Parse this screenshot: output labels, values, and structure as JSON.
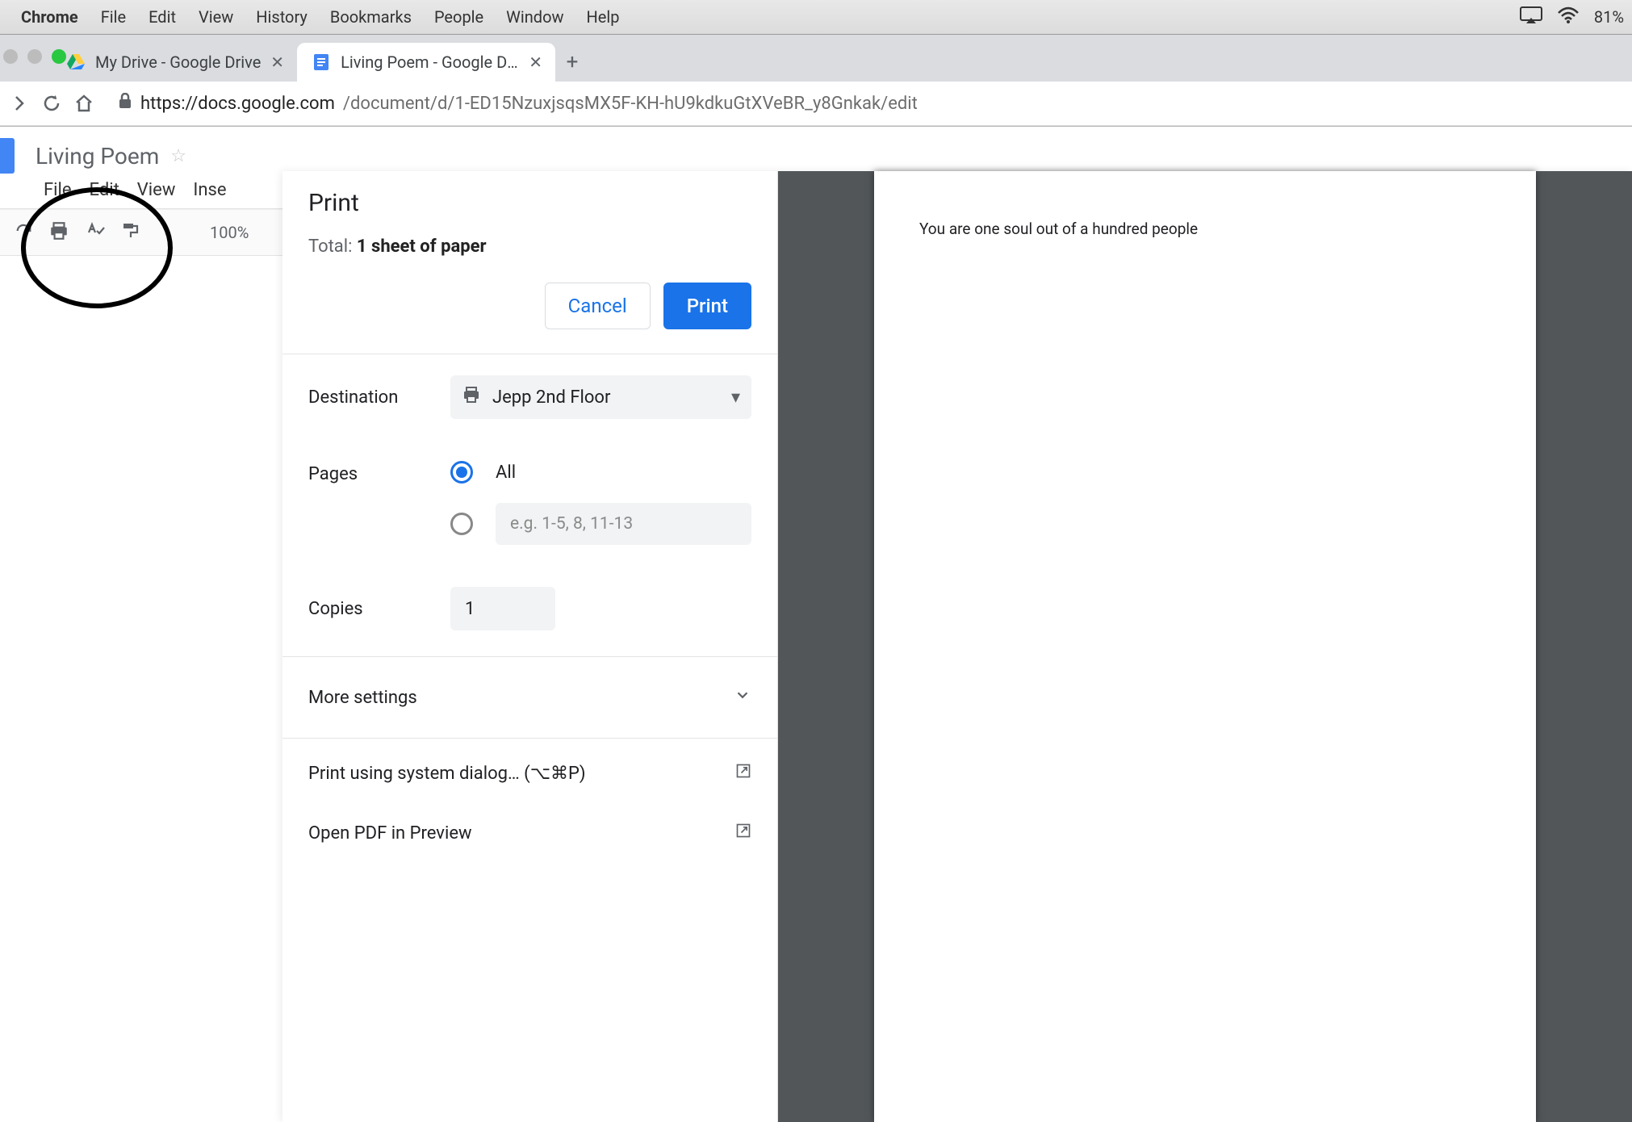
{
  "menubar": {
    "app": "Chrome",
    "items": [
      "File",
      "Edit",
      "View",
      "History",
      "Bookmarks",
      "People",
      "Window",
      "Help"
    ],
    "battery": "81%"
  },
  "tabs": [
    {
      "title": "My Drive - Google Drive",
      "active": false
    },
    {
      "title": "Living Poem - Google Docs",
      "active": true
    }
  ],
  "url": {
    "scheme_host": "https://docs.google.com",
    "path": "/document/d/1-ED15NzuxjsqsMX5F-KH-hU9kdkuGtXVeBR_y8Gnkak/edit"
  },
  "docs": {
    "title": "Living Poem",
    "menu": [
      "File",
      "Edit",
      "View",
      "Inse"
    ],
    "zoom": "100%"
  },
  "print": {
    "title": "Print",
    "total_prefix": "Total: ",
    "total_value": "1 sheet of paper",
    "cancel": "Cancel",
    "print": "Print",
    "destination_label": "Destination",
    "destination_value": "Jepp 2nd Floor",
    "pages_label": "Pages",
    "pages_all": "All",
    "pages_range_placeholder": "e.g. 1-5, 8, 11-13",
    "copies_label": "Copies",
    "copies_value": "1",
    "more_settings": "More settings",
    "system_dialog": "Print using system dialog… (⌥⌘P)",
    "open_pdf": "Open PDF in Preview"
  },
  "preview": {
    "line1": "You are one soul out of a hundred people"
  }
}
